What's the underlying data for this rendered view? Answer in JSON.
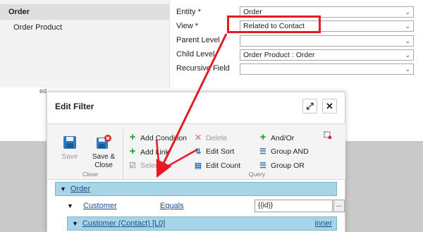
{
  "left_nav": {
    "items": [
      {
        "label": "Order"
      },
      {
        "label": "Order Product"
      }
    ]
  },
  "form": {
    "fields": [
      {
        "label": "Entity *",
        "value": "Order"
      },
      {
        "label": "View *",
        "value": "Related to Contact"
      },
      {
        "label": "Parent Level",
        "value": ""
      },
      {
        "label": "Child Level",
        "value": "Order Product : Order"
      },
      {
        "label": "Recursive Field",
        "value": ""
      }
    ]
  },
  "behind_text": "ed",
  "dialog": {
    "title": "Edit Filter",
    "maximize_glyph": "⤢",
    "close_glyph": "✕",
    "ribbon": {
      "save_label": "Save",
      "save_close_label": "Save & Close",
      "group_close": "Close",
      "group_query": "Query",
      "add_condition": "Add Condition",
      "add_link": "Add Link",
      "select": "Select",
      "delete": "Delete",
      "edit_sort": "Edit Sort",
      "edit_count": "Edit Count",
      "and_or": "And/Or",
      "group_and": "Group AND",
      "group_or": "Group OR"
    },
    "tree": {
      "root_label": "Order",
      "condition": {
        "field": "Customer",
        "operator": "Equals",
        "value": "{{id}}",
        "button": "..."
      },
      "link": {
        "label": "Customer (Contact) [L0]",
        "join": "inner"
      }
    }
  },
  "colors": {
    "highlight": "#e51b23",
    "selected_row": "#a6d5e8",
    "add_icon": "#1f9a35",
    "save_icon": "#1f6fb5"
  },
  "icons": [
    "chevron-down-icon",
    "save-icon",
    "save-close-icon",
    "plus-icon",
    "delete-icon",
    "checkbox-icon",
    "sort-icon",
    "count-icon",
    "and-or-icon",
    "group-icon",
    "maximize-icon",
    "close-icon",
    "expand-arrow-icon"
  ]
}
